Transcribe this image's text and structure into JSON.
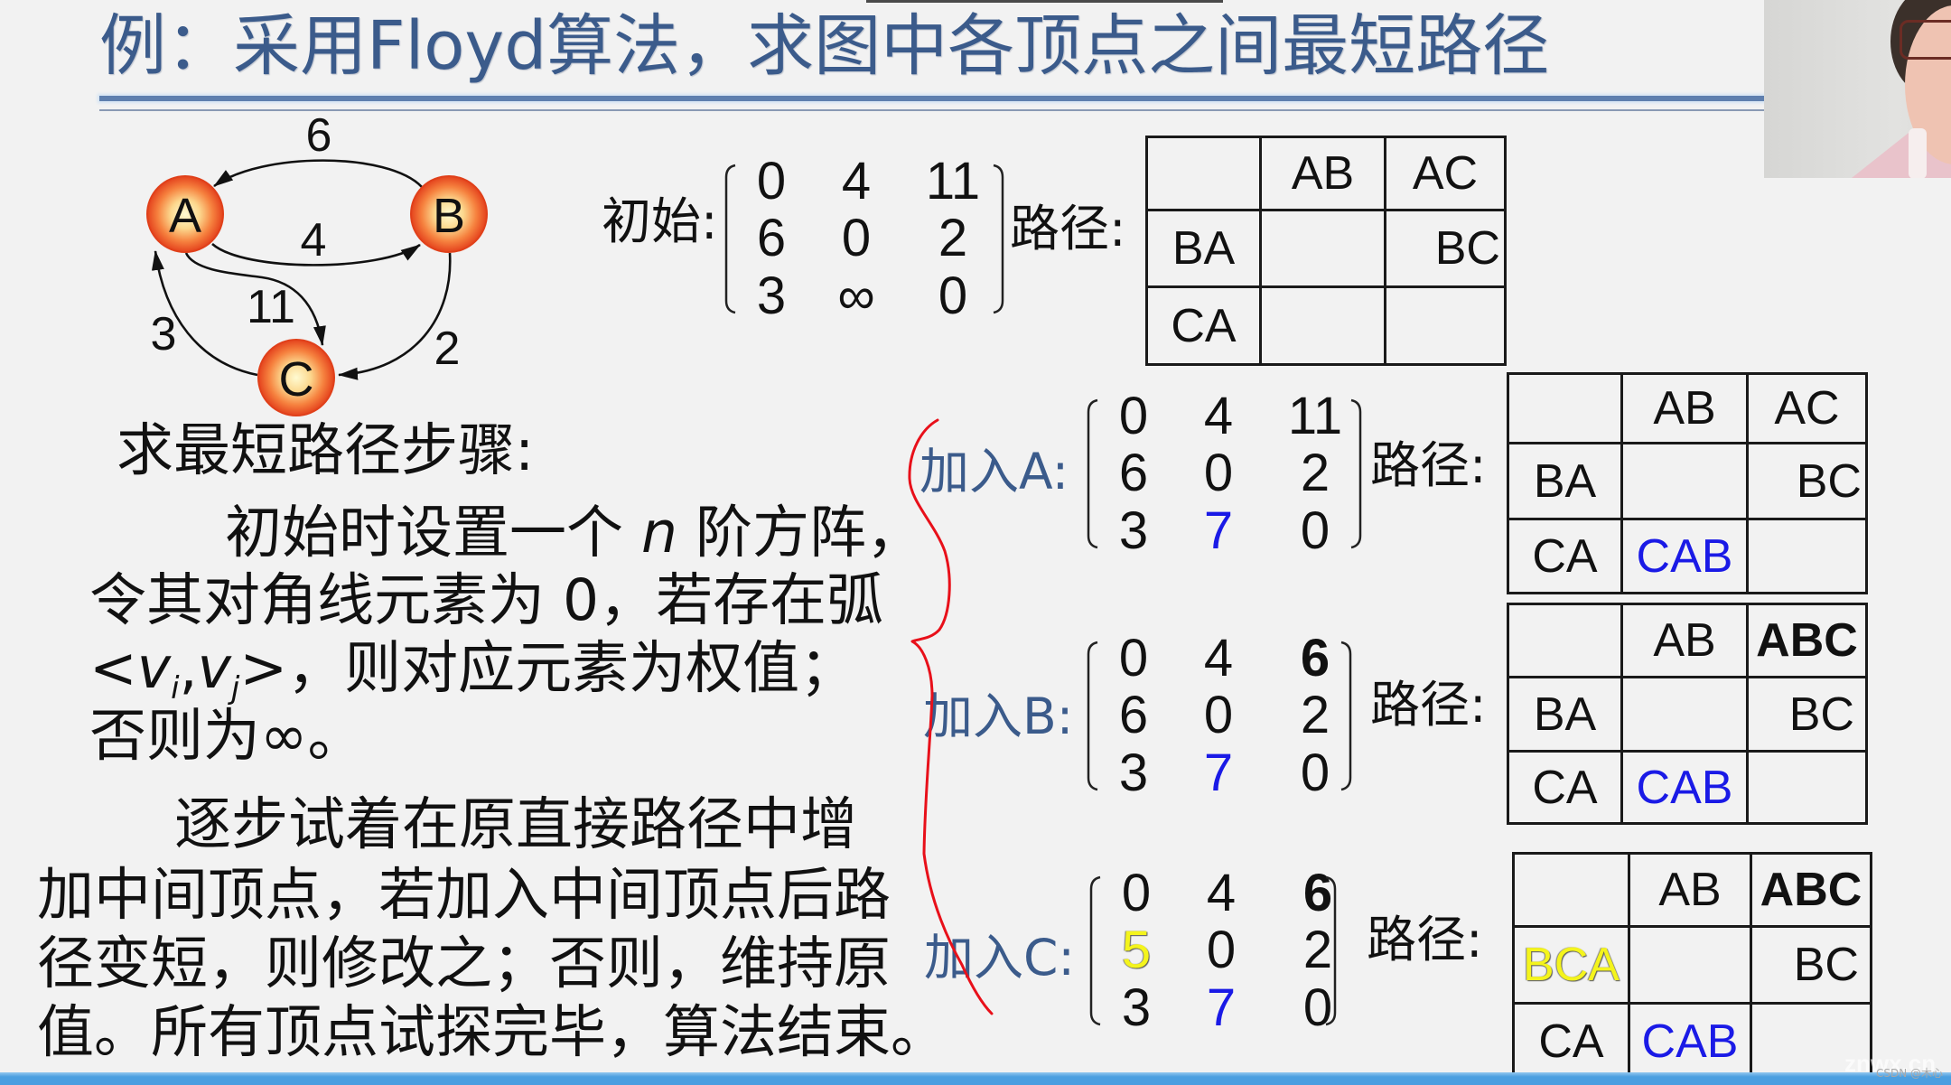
{
  "title": "例：采用Floyd算法，求图中各顶点之间最短路径",
  "colors": {
    "title": "#3b5b8b",
    "background": "#f2f2f2",
    "highlight_blue": "#1a1ae6",
    "highlight_yellow": "#f4f41c",
    "annotation_red": "#e8101a",
    "node_center": "#fffbd2",
    "node_edge": "#e4421d",
    "bottom_bar": "#4b9fe0"
  },
  "graph": {
    "nodes": [
      {
        "id": "A",
        "label": "A"
      },
      {
        "id": "B",
        "label": "B"
      },
      {
        "id": "C",
        "label": "C"
      }
    ],
    "edges": [
      {
        "from": "B",
        "to": "A",
        "weight": "6"
      },
      {
        "from": "A",
        "to": "B",
        "weight": "4"
      },
      {
        "from": "A",
        "to": "C",
        "weight": "11"
      },
      {
        "from": "C",
        "to": "A",
        "weight": "3"
      },
      {
        "from": "B",
        "to": "C",
        "weight": "2"
      }
    ]
  },
  "steps": {
    "heading": "求最短路径步骤:",
    "paragraph1": {
      "line1_pre": "初始时设置一个 ",
      "line1_var": "n",
      "line1_post": " 阶方阵，",
      "line2": "令其对角线元素为 0，若存在弧",
      "line3": {
        "open": "<",
        "var": "v",
        "sub_i": "i",
        "sep": ",",
        "sub_j": "j",
        "close": ">",
        "rest": "，则对应元素为权值；"
      },
      "line4": "否则为∞。"
    },
    "paragraph2": [
      "逐步试着在原直接路径中增",
      "加中间顶点，若加入中间顶点后路",
      "径变短，则修改之；否则，维持原",
      "值。所有顶点试探完毕，算法结束。"
    ]
  },
  "stages": [
    {
      "label": "初始:",
      "path_label": "路径:",
      "matrix": [
        [
          {
            "value": "0",
            "style": null
          },
          {
            "value": "4",
            "style": null
          },
          {
            "value": "11",
            "style": null
          }
        ],
        [
          {
            "value": "6",
            "style": null
          },
          {
            "value": "0",
            "style": null
          },
          {
            "value": "2",
            "style": null
          }
        ],
        [
          {
            "value": "3",
            "style": null
          },
          {
            "value": "∞",
            "style": null
          },
          {
            "value": "0",
            "style": null
          }
        ]
      ],
      "paths": [
        [
          {
            "value": "",
            "style": null
          },
          {
            "value": "AB",
            "style": null
          },
          {
            "value": "AC",
            "style": null
          }
        ],
        [
          {
            "value": "BA",
            "style": null
          },
          {
            "value": "",
            "style": null
          },
          {
            "value": "BC",
            "style": null
          }
        ],
        [
          {
            "value": "CA",
            "style": null
          },
          {
            "value": "",
            "style": null
          },
          {
            "value": "",
            "style": null
          }
        ]
      ]
    },
    {
      "label": "加入A:",
      "path_label": "路径:",
      "matrix": [
        [
          {
            "value": "0",
            "style": null
          },
          {
            "value": "4",
            "style": null
          },
          {
            "value": "11",
            "style": null
          }
        ],
        [
          {
            "value": "6",
            "style": null
          },
          {
            "value": "0",
            "style": null
          },
          {
            "value": "2",
            "style": null
          }
        ],
        [
          {
            "value": "3",
            "style": null
          },
          {
            "value": "7",
            "style": "blue"
          },
          {
            "value": "0",
            "style": null
          }
        ]
      ],
      "paths": [
        [
          {
            "value": "",
            "style": null
          },
          {
            "value": "AB",
            "style": null
          },
          {
            "value": "AC",
            "style": null
          }
        ],
        [
          {
            "value": "BA",
            "style": null
          },
          {
            "value": "",
            "style": null
          },
          {
            "value": "BC",
            "style": null
          }
        ],
        [
          {
            "value": "CA",
            "style": null
          },
          {
            "value": "CAB",
            "style": "blue"
          },
          {
            "value": "",
            "style": null
          }
        ]
      ]
    },
    {
      "label": "加入B:",
      "path_label": "路径:",
      "matrix": [
        [
          {
            "value": "0",
            "style": null
          },
          {
            "value": "4",
            "style": null
          },
          {
            "value": "6",
            "style": "bold"
          }
        ],
        [
          {
            "value": "6",
            "style": null
          },
          {
            "value": "0",
            "style": null
          },
          {
            "value": "2",
            "style": null
          }
        ],
        [
          {
            "value": "3",
            "style": null
          },
          {
            "value": "7",
            "style": "blue"
          },
          {
            "value": "0",
            "style": null
          }
        ]
      ],
      "paths": [
        [
          {
            "value": "",
            "style": null
          },
          {
            "value": "AB",
            "style": null
          },
          {
            "value": "ABC",
            "style": "bold"
          }
        ],
        [
          {
            "value": "BA",
            "style": null
          },
          {
            "value": "",
            "style": null
          },
          {
            "value": "BC",
            "style": null
          }
        ],
        [
          {
            "value": "CA",
            "style": null
          },
          {
            "value": "CAB",
            "style": "blue"
          },
          {
            "value": "",
            "style": null
          }
        ]
      ]
    },
    {
      "label": "加入C:",
      "path_label": "路径:",
      "matrix": [
        [
          {
            "value": "0",
            "style": null
          },
          {
            "value": "4",
            "style": null
          },
          {
            "value": "6",
            "style": "bold"
          }
        ],
        [
          {
            "value": "5",
            "style": "yellow"
          },
          {
            "value": "0",
            "style": null
          },
          {
            "value": "2",
            "style": null
          }
        ],
        [
          {
            "value": "3",
            "style": null
          },
          {
            "value": "7",
            "style": "blue"
          },
          {
            "value": "0",
            "style": null
          }
        ]
      ],
      "paths": [
        [
          {
            "value": "",
            "style": null
          },
          {
            "value": "AB",
            "style": null
          },
          {
            "value": "ABC",
            "style": "bold"
          }
        ],
        [
          {
            "value": "BCA",
            "style": "yellow"
          },
          {
            "value": "",
            "style": null
          },
          {
            "value": "BC",
            "style": null
          }
        ],
        [
          {
            "value": "CA",
            "style": null
          },
          {
            "value": "CAB",
            "style": "blue"
          },
          {
            "value": "",
            "style": null
          }
        ]
      ]
    }
  ],
  "watermark": {
    "site": "znwx.cn",
    "credit": "CSDN @木心"
  }
}
